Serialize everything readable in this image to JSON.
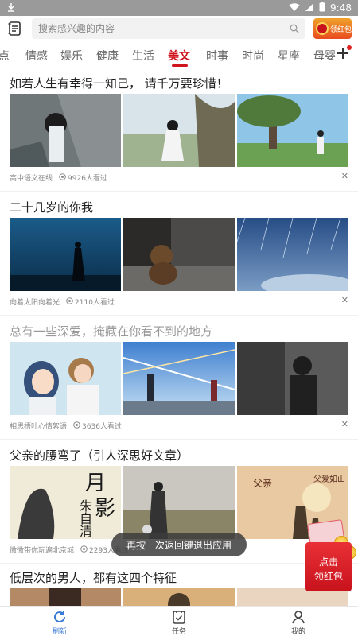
{
  "status_bar": {
    "time": "9:48"
  },
  "header": {
    "search_placeholder": "搜索感兴趣的内容",
    "redpack_label": "领红包"
  },
  "tabs": [
    {
      "label": "点"
    },
    {
      "label": "情感"
    },
    {
      "label": "娱乐"
    },
    {
      "label": "健康"
    },
    {
      "label": "生活"
    },
    {
      "label": "美文",
      "active": true
    },
    {
      "label": "时事"
    },
    {
      "label": "时尚"
    },
    {
      "label": "星座"
    },
    {
      "label": "母婴"
    }
  ],
  "articles": [
    {
      "title": "如若人生有幸得一知己， 请千万要珍惜！",
      "source": "高中语文在线",
      "views": "9926人看过",
      "read": false
    },
    {
      "title": "二十几岁的你我",
      "source": "向着太阳向着光",
      "views": "2110人看过",
      "read": false
    },
    {
      "title": "总有一些深爱，掩藏在你看不到的地方",
      "source": "相思梧叶心情絮语",
      "views": "3636人看过",
      "read": true
    },
    {
      "title": "父亲的腰弯了（引人深思好文章）",
      "source": "微微带你玩遍北京城",
      "views": "2293人看过",
      "read": false
    },
    {
      "title": "低层次的男人，都有这四个特征",
      "source": "",
      "views": "",
      "read": false
    }
  ],
  "image_text": {
    "calligraphy_1": "月",
    "calligraphy_2": "影",
    "calligraphy_3": "朱",
    "calligraphy_4": "自",
    "calligraphy_5": "清",
    "poster_a": "父亲",
    "poster_b": "父爱如山"
  },
  "toast": "再按一次返回键退出应用",
  "float_redpack": {
    "line1": "点击",
    "line2": "领红包"
  },
  "bottom_nav": [
    {
      "label": "刷新",
      "icon": "refresh-icon",
      "active": true
    },
    {
      "label": "任务",
      "icon": "task-icon",
      "active": false
    },
    {
      "label": "我的",
      "icon": "profile-icon",
      "active": false
    }
  ],
  "colors": {
    "accent": "#d0121b",
    "nav_active": "#3a7bd5"
  }
}
